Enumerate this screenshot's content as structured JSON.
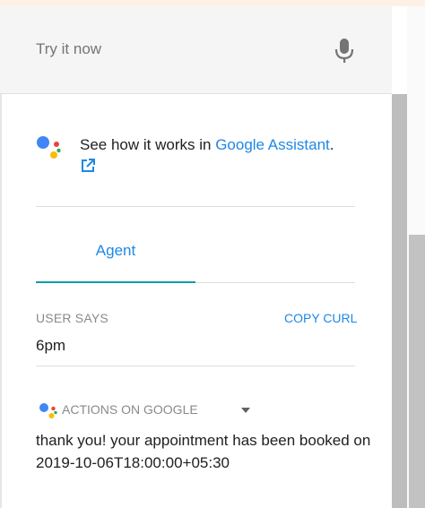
{
  "try_bar": {
    "placeholder": "Try it now",
    "mic_icon": "microphone-icon"
  },
  "assistant_promo": {
    "prefix": "See how it works in ",
    "link": "Google Assistant",
    "suffix": ".",
    "icon": "external-link-icon",
    "logo": "google-assistant-logo"
  },
  "tabs": [
    {
      "label": "Agent",
      "active": true
    }
  ],
  "user_says": {
    "label": "USER SAYS",
    "copy_label": "COPY CURL",
    "value": "6pm"
  },
  "response": {
    "platform_label": "ACTIONS ON GOOGLE",
    "platform_icon": "google-assistant-logo",
    "dropdown_icon": "caret-down-icon",
    "text": "thank you! your appointment has been booked on 2019-10-06T18:00:00+05:30"
  },
  "colors": {
    "link": "#1e88e5",
    "tab_underline": "#0f9aa8",
    "google_blue": "#4285f4",
    "google_red": "#ea4335",
    "google_yellow": "#fbbc05",
    "google_green": "#34a853"
  }
}
